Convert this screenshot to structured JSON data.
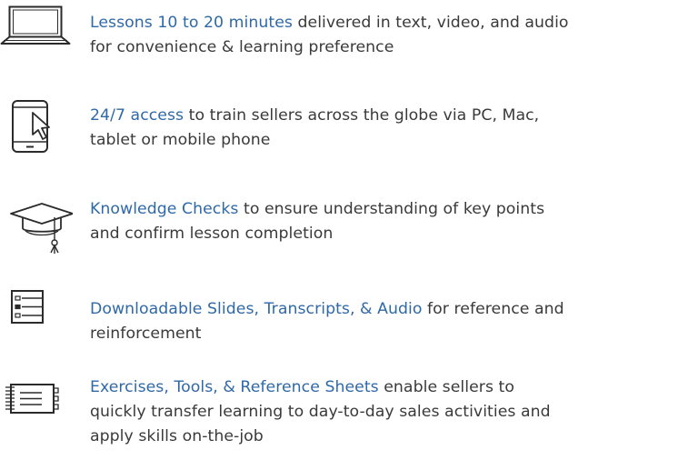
{
  "features": [
    {
      "icon": "laptop-icon",
      "highlight": "Lessons 10 to 20 minutes",
      "line1_rest": " delivered in text, video, and audio",
      "line2": "for convenience & learning preference"
    },
    {
      "icon": "tablet-touch-icon",
      "highlight": "24/7 access",
      "line1_rest": " to train sellers across the globe via PC, Mac,",
      "line2": "tablet or mobile phone"
    },
    {
      "icon": "graduation-cap-icon",
      "highlight": "Knowledge Checks",
      "line1_rest": " to ensure understanding of key points",
      "line2": "and confirm lesson completion"
    },
    {
      "icon": "checklist-icon",
      "highlight": "Downloadable Slides, Transcripts, & Audio",
      "line1_rest": " for reference and",
      "line2": "reinforcement"
    },
    {
      "icon": "notebook-icon",
      "highlight": "Exercises, Tools, & Reference Sheets",
      "line1_rest": " enable sellers to",
      "line2": "quickly transfer learning to day-to-day sales activities and",
      "line3": "apply skills on-the-job"
    }
  ],
  "colors": {
    "highlight": "#2f69a8",
    "text": "#3a3a3a",
    "icon": "#2b2b2b"
  }
}
